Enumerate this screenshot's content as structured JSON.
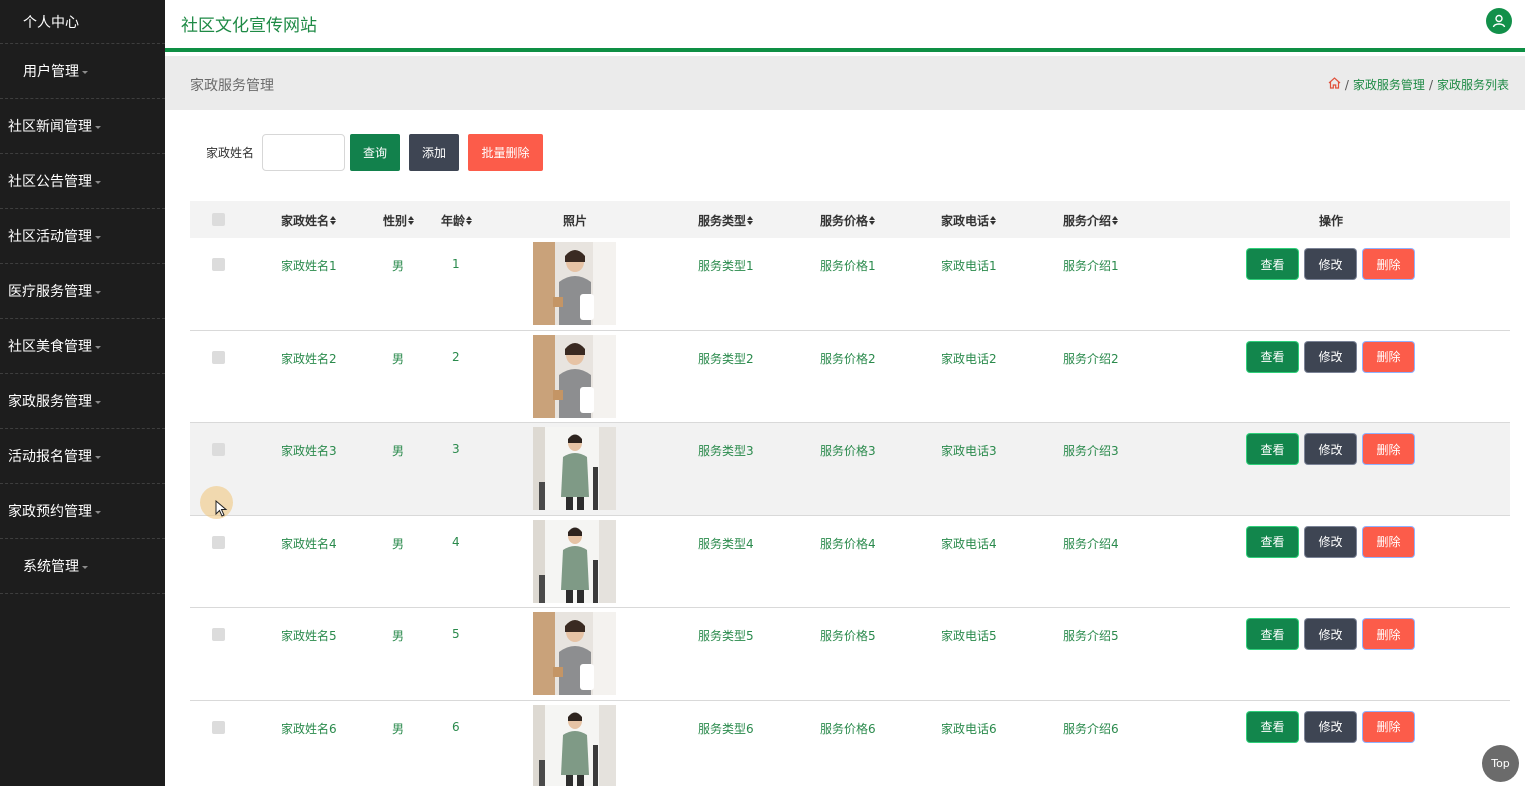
{
  "sidebar": {
    "items": [
      {
        "label": "个人中心"
      },
      {
        "label": "用户管理"
      },
      {
        "label": "社区新闻管理"
      },
      {
        "label": "社区公告管理"
      },
      {
        "label": "社区活动管理"
      },
      {
        "label": "医疗服务管理"
      },
      {
        "label": "社区美食管理"
      },
      {
        "label": "家政服务管理"
      },
      {
        "label": "活动报名管理"
      },
      {
        "label": "家政预约管理"
      },
      {
        "label": "系统管理"
      }
    ]
  },
  "header": {
    "title": "社区文化宣传网站",
    "avatar_icon": "user-icon"
  },
  "breadcrumb": {
    "page_title": "家政服务管理",
    "home_icon": "home-icon",
    "separator": "/",
    "items": [
      "家政服务管理",
      "家政服务列表"
    ]
  },
  "search": {
    "label": "家政姓名",
    "value": "",
    "query_button": "查询",
    "add_button": "添加",
    "batch_delete_button": "批量删除"
  },
  "table": {
    "columns": [
      "家政姓名",
      "性别",
      "年龄",
      "照片",
      "服务类型",
      "服务价格",
      "家政电话",
      "服务介绍",
      "操作"
    ],
    "rows": [
      {
        "name": "家政姓名1",
        "gender": "男",
        "age": "1",
        "type": "服务类型1",
        "price": "服务价格1",
        "phone": "家政电话1",
        "intro": "服务介绍1"
      },
      {
        "name": "家政姓名2",
        "gender": "男",
        "age": "2",
        "type": "服务类型2",
        "price": "服务价格2",
        "phone": "家政电话2",
        "intro": "服务介绍2"
      },
      {
        "name": "家政姓名3",
        "gender": "男",
        "age": "3",
        "type": "服务类型3",
        "price": "服务价格3",
        "phone": "家政电话3",
        "intro": "服务介绍3"
      },
      {
        "name": "家政姓名4",
        "gender": "男",
        "age": "4",
        "type": "服务类型4",
        "price": "服务价格4",
        "phone": "家政电话4",
        "intro": "服务介绍4"
      },
      {
        "name": "家政姓名5",
        "gender": "男",
        "age": "5",
        "type": "服务类型5",
        "price": "服务价格5",
        "phone": "家政电话5",
        "intro": "服务介绍5"
      },
      {
        "name": "家政姓名6",
        "gender": "男",
        "age": "6",
        "type": "服务类型6",
        "price": "服务价格6",
        "phone": "家政电话6",
        "intro": "服务介绍6"
      }
    ],
    "actions": {
      "view": "查看",
      "edit": "修改",
      "delete": "删除"
    }
  },
  "top_button": "Top",
  "colors": {
    "accent": "#12864c",
    "sidebar_bg": "#1d1d1d",
    "danger": "#fc5c4a",
    "dark_button": "#3e4553"
  }
}
